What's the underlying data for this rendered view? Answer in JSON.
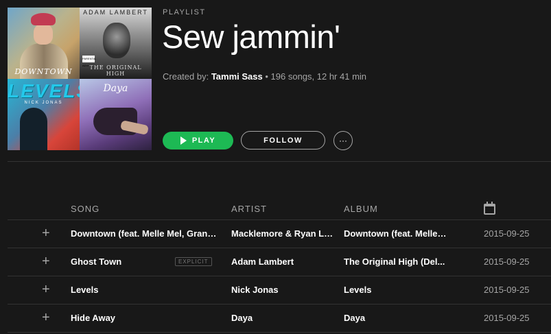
{
  "playlist": {
    "eyebrow": "PLAYLIST",
    "title": "Sew jammin'",
    "created_by_label": "Created by:",
    "creator": "Tammi Sass",
    "stats": "• 196 songs, 12 hr 41 min"
  },
  "covers": {
    "tile1_caption": "DOWNTOWN",
    "tile2_top": "ADAM LAMBERT",
    "tile2_bottom": "THE ORIGINAL HIGH",
    "tile2_advisory": "PARENTAL ADVISORY",
    "tile3_big": "LEVELS",
    "tile3_small": "NICK JONAS",
    "tile4_caption": "Daya"
  },
  "actions": {
    "play_label": "PLAY",
    "follow_label": "FOLLOW",
    "more_label": "···"
  },
  "table": {
    "headers": {
      "song": "SONG",
      "artist": "ARTIST",
      "album": "ALBUM"
    },
    "date_icon": "calendar-icon",
    "rows": [
      {
        "add": "+",
        "song": "Downtown (feat. Melle Mel, Grand...",
        "explicit": "",
        "artist": "Macklemore & Ryan Le...",
        "album": "Downtown (feat. Melle ...",
        "date": "2015-09-25"
      },
      {
        "add": "+",
        "song": "Ghost Town",
        "explicit": "EXPLICIT",
        "artist": "Adam Lambert",
        "album": "The Original High (Del...",
        "date": "2015-09-25"
      },
      {
        "add": "+",
        "song": "Levels",
        "explicit": "",
        "artist": "Nick Jonas",
        "album": "Levels",
        "date": "2015-09-25"
      },
      {
        "add": "+",
        "song": "Hide Away",
        "explicit": "",
        "artist": "Daya",
        "album": "Daya",
        "date": "2015-09-25"
      }
    ]
  },
  "colors": {
    "background": "#181818",
    "accent": "#1db954",
    "muted": "#a6a6a6"
  }
}
